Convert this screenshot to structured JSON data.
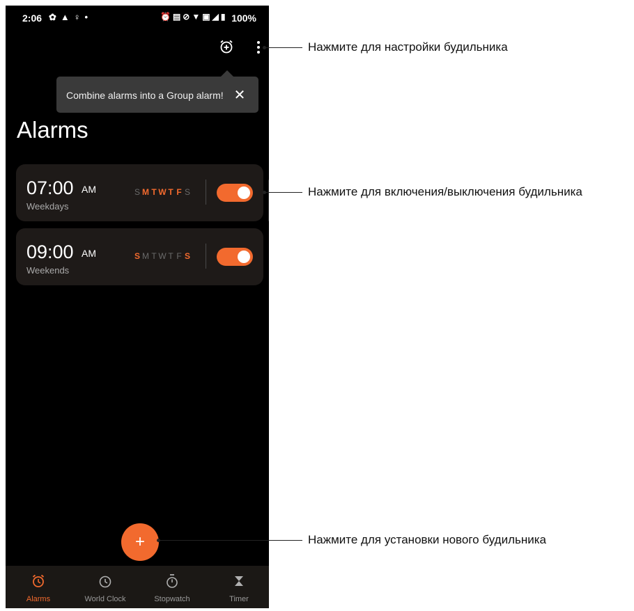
{
  "colors": {
    "accent": "#f26a2e",
    "background": "#000000",
    "card": "#1e1a18",
    "tooltip": "#3a3a3a"
  },
  "status_bar": {
    "time": "2:06",
    "left_icons": [
      "settings-icon",
      "warning-icon",
      "lightbulb-icon",
      "dot-icon"
    ],
    "right_icons": [
      "alarm-icon",
      "sim-icon",
      "mute-icon",
      "wifi-icon",
      "volte-icon",
      "signal-icon",
      "battery-icon"
    ],
    "battery": "100%"
  },
  "toolbar": {
    "icons": [
      "add-alarm-icon",
      "more-vert-icon"
    ]
  },
  "tooltip": {
    "text": "Combine alarms into a Group alarm!",
    "close_icon": "close-icon"
  },
  "page_title": "Alarms",
  "alarms": [
    {
      "time": "07:00",
      "ampm": "AM",
      "label": "Weekdays",
      "days": [
        "S",
        "M",
        "T",
        "W",
        "T",
        "F",
        "S"
      ],
      "days_active": [
        false,
        true,
        true,
        true,
        true,
        true,
        false
      ],
      "enabled": true
    },
    {
      "time": "09:00",
      "ampm": "AM",
      "label": "Weekends",
      "days": [
        "S",
        "M",
        "T",
        "W",
        "T",
        "F",
        "S"
      ],
      "days_active": [
        true,
        false,
        false,
        false,
        false,
        false,
        true
      ],
      "enabled": true
    }
  ],
  "fab": {
    "label": "+"
  },
  "bottom_nav": [
    {
      "label": "Alarms",
      "icon": "alarm-clock-icon",
      "active": true
    },
    {
      "label": "World Clock",
      "icon": "clock-icon",
      "active": false
    },
    {
      "label": "Stopwatch",
      "icon": "stopwatch-icon",
      "active": false
    },
    {
      "label": "Timer",
      "icon": "hourglass-icon",
      "active": false
    }
  ],
  "callouts": {
    "settings": "Нажмите для настройки будильника",
    "toggle": "Нажмите для включения/выключения будильника",
    "new_alarm": "Нажмите для установки нового будильника"
  }
}
